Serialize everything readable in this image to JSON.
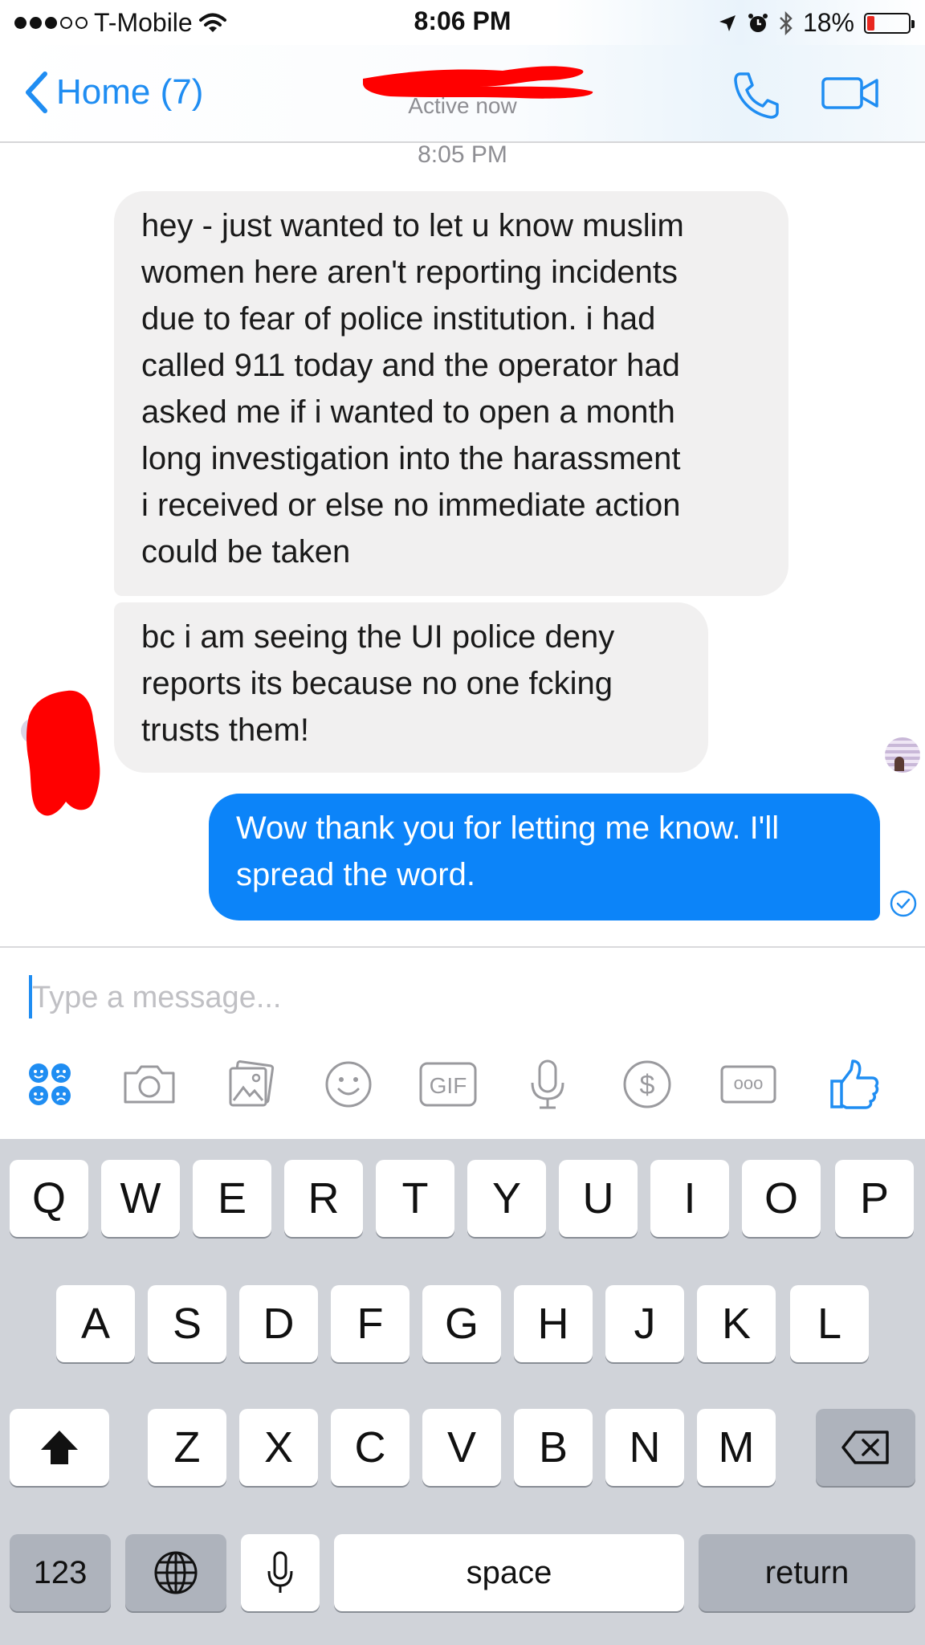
{
  "status_bar": {
    "carrier": "T-Mobile",
    "time": "8:06 PM",
    "battery": "18%",
    "battery_level": 0.18,
    "signal_dots_filled": 3,
    "signal_dots_total": 5
  },
  "header": {
    "back_label": "Home (7)",
    "status": "Active now"
  },
  "conversation": {
    "timestamp": "8:05 PM",
    "messages": [
      {
        "direction": "incoming",
        "lines": [
          "hey - just wanted to let u know muslim",
          "women here aren't reporting incidents",
          "due to fear of police institution. i had",
          "called 911 today and the operator had",
          "asked me if i wanted to open a month",
          "long investigation into the harassment",
          "i received or else no immediate action",
          "could be taken"
        ]
      },
      {
        "direction": "incoming",
        "lines": [
          "bc i am seeing the UI police deny",
          "reports its because no one fcking",
          "trusts them!"
        ]
      },
      {
        "direction": "outgoing",
        "lines": [
          "Wow thank you for letting me know. I'll",
          "spread the word."
        ]
      }
    ]
  },
  "composer": {
    "placeholder": "Type a message...",
    "value": ""
  },
  "toolbar": {
    "gif_label": "GIF",
    "money_label": "$",
    "more_label": "ooo",
    "icons": [
      "stickers-icon",
      "camera-icon",
      "gallery-icon",
      "emoji-icon",
      "gif-icon",
      "microphone-icon",
      "payment-icon",
      "more-icon",
      "like-icon"
    ]
  },
  "keyboard": {
    "row1": [
      "Q",
      "W",
      "E",
      "R",
      "T",
      "Y",
      "U",
      "I",
      "O",
      "P"
    ],
    "row2": [
      "A",
      "S",
      "D",
      "F",
      "G",
      "H",
      "J",
      "K",
      "L"
    ],
    "row3": [
      "Z",
      "X",
      "C",
      "V",
      "B",
      "N",
      "M"
    ],
    "numbers_label": "123",
    "space_label": "space",
    "return_label": "return"
  },
  "colors": {
    "accent": "#1f8df2",
    "outgoing_bubble": "#0c84f9",
    "incoming_bubble": "#f1f0f0",
    "redaction": "#ff0000",
    "keyboard_bg": "#d0d3d9"
  }
}
